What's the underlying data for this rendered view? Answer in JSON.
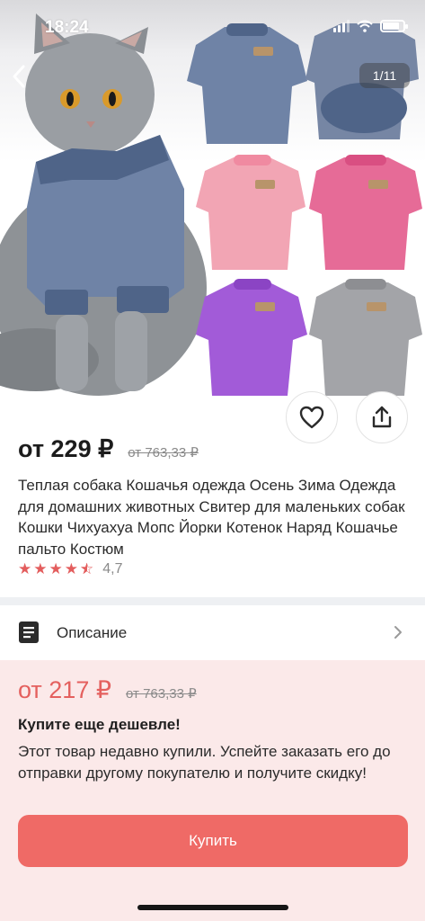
{
  "status_bar": {
    "time": "18:24"
  },
  "gallery": {
    "counter": "1/11"
  },
  "product": {
    "price": "от 229 ₽",
    "old_price": "от 763,33 ₽",
    "title": "Теплая собака Кошачья одежда Осень Зима Одежда для домашних животных Свитер для маленьких собак Кошки Чихуахуа Мопс Йорки Котенок Наряд Кошачье пальто Костюм",
    "rating_value": "4,7",
    "rating_stars": 4.5
  },
  "description_row": {
    "label": "Описание"
  },
  "promo": {
    "price": "от 217 ₽",
    "old_price": "от 763,33 ₽",
    "headline": "Купите еще дешевле!",
    "text": "Этот товар недавно купили. Успейте заказать его до отправки другому покупателю и получите скидку!",
    "buy_label": "Купить"
  },
  "colors": {
    "accent": "#ef6a66",
    "promo_bg": "#fbe9e9",
    "star": "#e35d5d"
  },
  "icons": [
    "back-arrow-icon",
    "heart-icon",
    "share-icon",
    "document-icon",
    "chevron-right-icon"
  ]
}
